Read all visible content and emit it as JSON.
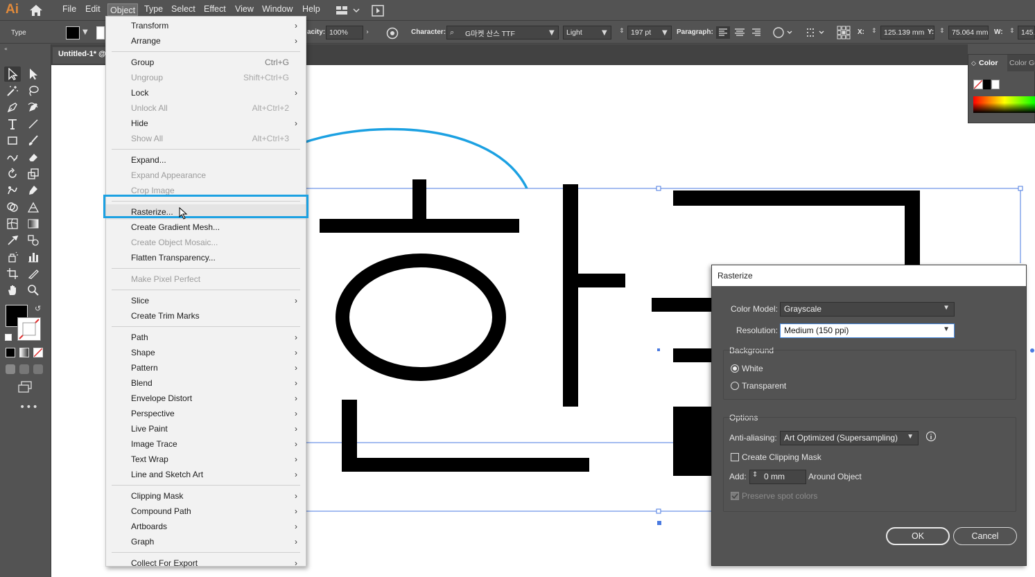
{
  "app": {
    "logo": "Ai"
  },
  "menubar": {
    "items": [
      "File",
      "Edit",
      "Object",
      "Type",
      "Select",
      "Effect",
      "View",
      "Window",
      "Help"
    ],
    "active": "Object"
  },
  "control_bar": {
    "mode_label": "Type",
    "opacity_label": "acity:",
    "opacity_value": "100%",
    "character_label": "Character:",
    "font_family": "G마켓 산스 TTF",
    "font_style": "Light",
    "font_size": "197 pt",
    "paragraph_label": "Paragraph:",
    "x_label": "X:",
    "x_value": "125.139 mm",
    "y_label": "Y:",
    "y_value": "75.064 mm",
    "w_label": "W:",
    "w_value": "145."
  },
  "document": {
    "tab_title": "Untitled-1* @"
  },
  "color_panel": {
    "tab_active": "Color",
    "tab_other": "Color Gu"
  },
  "object_menu": {
    "items": [
      {
        "label": "Transform",
        "shortcut": "",
        "submenu": true,
        "disabled": false
      },
      {
        "label": "Arrange",
        "shortcut": "",
        "submenu": true,
        "disabled": false
      },
      {
        "label": "Group",
        "shortcut": "Ctrl+G",
        "submenu": false,
        "disabled": false
      },
      {
        "label": "Ungroup",
        "shortcut": "Shift+Ctrl+G",
        "submenu": false,
        "disabled": true
      },
      {
        "label": "Lock",
        "shortcut": "",
        "submenu": true,
        "disabled": false
      },
      {
        "label": "Unlock All",
        "shortcut": "Alt+Ctrl+2",
        "submenu": false,
        "disabled": true
      },
      {
        "label": "Hide",
        "shortcut": "",
        "submenu": true,
        "disabled": false
      },
      {
        "label": "Show All",
        "shortcut": "Alt+Ctrl+3",
        "submenu": false,
        "disabled": true
      },
      {
        "label": "Expand...",
        "shortcut": "",
        "submenu": false,
        "disabled": false
      },
      {
        "label": "Expand Appearance",
        "shortcut": "",
        "submenu": false,
        "disabled": true
      },
      {
        "label": "Crop Image",
        "shortcut": "",
        "submenu": false,
        "disabled": true
      },
      {
        "label": "Rasterize...",
        "shortcut": "",
        "submenu": false,
        "disabled": false
      },
      {
        "label": "Create Gradient Mesh...",
        "shortcut": "",
        "submenu": false,
        "disabled": false
      },
      {
        "label": "Create Object Mosaic...",
        "shortcut": "",
        "submenu": false,
        "disabled": true
      },
      {
        "label": "Flatten Transparency...",
        "shortcut": "",
        "submenu": false,
        "disabled": false
      },
      {
        "label": "Make Pixel Perfect",
        "shortcut": "",
        "submenu": false,
        "disabled": true
      },
      {
        "label": "Slice",
        "shortcut": "",
        "submenu": true,
        "disabled": false
      },
      {
        "label": "Create Trim Marks",
        "shortcut": "",
        "submenu": false,
        "disabled": false
      },
      {
        "label": "Path",
        "shortcut": "",
        "submenu": true,
        "disabled": false
      },
      {
        "label": "Shape",
        "shortcut": "",
        "submenu": true,
        "disabled": false
      },
      {
        "label": "Pattern",
        "shortcut": "",
        "submenu": true,
        "disabled": false
      },
      {
        "label": "Blend",
        "shortcut": "",
        "submenu": true,
        "disabled": false
      },
      {
        "label": "Envelope Distort",
        "shortcut": "",
        "submenu": true,
        "disabled": false
      },
      {
        "label": "Perspective",
        "shortcut": "",
        "submenu": true,
        "disabled": false
      },
      {
        "label": "Live Paint",
        "shortcut": "",
        "submenu": true,
        "disabled": false
      },
      {
        "label": "Image Trace",
        "shortcut": "",
        "submenu": true,
        "disabled": false
      },
      {
        "label": "Text Wrap",
        "shortcut": "",
        "submenu": true,
        "disabled": false
      },
      {
        "label": "Line and Sketch Art",
        "shortcut": "",
        "submenu": true,
        "disabled": false
      },
      {
        "label": "Clipping Mask",
        "shortcut": "",
        "submenu": true,
        "disabled": false
      },
      {
        "label": "Compound Path",
        "shortcut": "",
        "submenu": true,
        "disabled": false
      },
      {
        "label": "Artboards",
        "shortcut": "",
        "submenu": true,
        "disabled": false
      },
      {
        "label": "Graph",
        "shortcut": "",
        "submenu": true,
        "disabled": false
      },
      {
        "label": "Collect For Export",
        "shortcut": "",
        "submenu": true,
        "disabled": false
      }
    ],
    "highlighted": "Rasterize..."
  },
  "rasterize_dialog": {
    "title": "Rasterize",
    "color_model_label": "Color Model:",
    "color_model_value": "Grayscale",
    "resolution_label": "Resolution:",
    "resolution_value": "Medium (150 ppi)",
    "background_label": "Background",
    "bg_white": "White",
    "bg_transparent": "Transparent",
    "bg_selected": "White",
    "options_label": "Options",
    "anti_aliasing_label": "Anti-aliasing:",
    "anti_aliasing_value": "Art Optimized (Supersampling)",
    "clipping_mask_label": "Create Clipping Mask",
    "clipping_mask_checked": false,
    "add_label": "Add:",
    "add_value": "0 mm",
    "around_label": "Around Object",
    "preserve_label": "Preserve spot colors",
    "preserve_checked": true,
    "preserve_disabled": true,
    "ok_label": "OK",
    "cancel_label": "Cancel"
  },
  "colors": {
    "accent_highlight": "#1ca1e2",
    "selection_line": "#4a7ae0",
    "ui_bg": "#535353"
  }
}
